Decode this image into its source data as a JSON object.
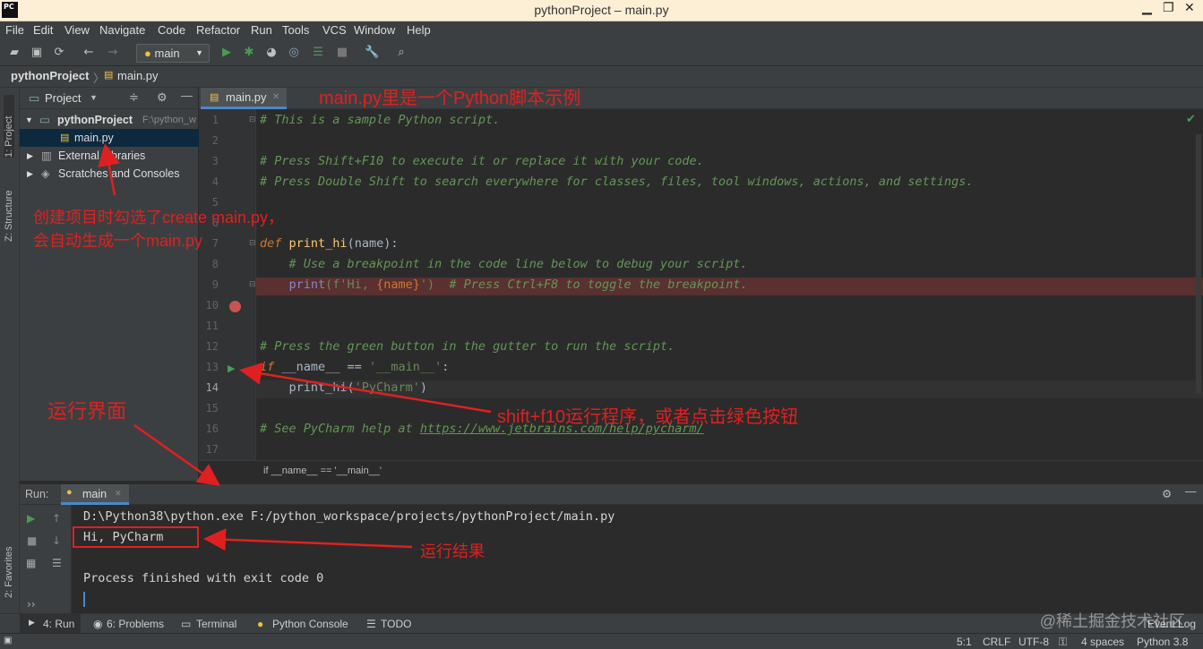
{
  "window": {
    "title": "pythonProject – main.py",
    "logo": "PC"
  },
  "menu": [
    "File",
    "Edit",
    "View",
    "Navigate",
    "Code",
    "Refactor",
    "Run",
    "Tools",
    "VCS",
    "Window",
    "Help"
  ],
  "toolbar": {
    "run_config": "main"
  },
  "breadcrumb": {
    "project": "pythonProject",
    "file": "main.py"
  },
  "left_tools": {
    "project": "1: Project",
    "structure": "Z: Structure",
    "favorites": "2: Favorites"
  },
  "project_panel": {
    "header": "Project",
    "root": "pythonProject",
    "root_path": "F:\\python_w",
    "file": "main.py",
    "external": "External Libraries",
    "scratches": "Scratches and Consoles"
  },
  "editor": {
    "tab": "main.py",
    "lines": [
      "1",
      "2",
      "3",
      "4",
      "5",
      "6",
      "7",
      "8",
      "9",
      "10",
      "11",
      "12",
      "13",
      "14",
      "15",
      "16",
      "17"
    ],
    "l1": "# This is a sample Python script.",
    "l3": "# Press Shift+F10 to execute it or replace it with your code.",
    "l4": "# Press Double Shift to search everywhere for classes, files, tool windows, actions, and settings.",
    "l7_def": "def",
    "l7_fn": "print_hi",
    "l7_rest": "(name):",
    "l8": "# Use a breakpoint in the code line below to debug your script.",
    "l9_print": "print",
    "l9_str1": "(f'Hi, ",
    "l9_var": "{name}",
    "l9_str2": "')",
    "l9_cm": "# Press Ctrl+F8 to toggle the breakpoint.",
    "l12": "# Press the green button in the gutter to run the script.",
    "l13_if": "if",
    "l13_rest": " __name__ == ",
    "l13_str": "'__main__'",
    "l13_colon": ":",
    "l14_call": "print_hi(",
    "l14_str": "'PyCharm'",
    "l14_close": ")",
    "l16_cm": "# See PyCharm help at ",
    "l16_link": "https://www.jetbrains.com/help/pycharm/",
    "crumb": "if __name__ == '__main__'"
  },
  "run": {
    "label": "Run:",
    "tab": "main",
    "cmd": "D:\\Python38\\python.exe F:/python_workspace/projects/pythonProject/main.py",
    "out1": "Hi, PyCharm",
    "out2": "Process finished with exit code 0"
  },
  "bottom_tabs": {
    "run": "4: Run",
    "problems": "6: Problems",
    "terminal": "Terminal",
    "console": "Python Console",
    "todo": "TODO",
    "eventlog": "Event Log"
  },
  "status": {
    "pos": "5:1",
    "crlf": "CRLF",
    "enc": "UTF-8",
    "indent": "4 spaces",
    "interp": "Python 3.8"
  },
  "annotations": {
    "a1": "main.py里是一个Python脚本示例",
    "a2_l1": "创建项目时勾选了create main.py，",
    "a2_l2": "会自动生成一个main.py",
    "a3": "运行界面",
    "a4": "shift+f10运行程序，或者点击绿色按钮",
    "a5": "运行结果"
  },
  "watermark": "@稀土掘金技术社区",
  "colors": {
    "accent": "#4a88c7",
    "annotation": "#e02020",
    "run_green": "#499c54",
    "breakpoint": "#c75450"
  }
}
